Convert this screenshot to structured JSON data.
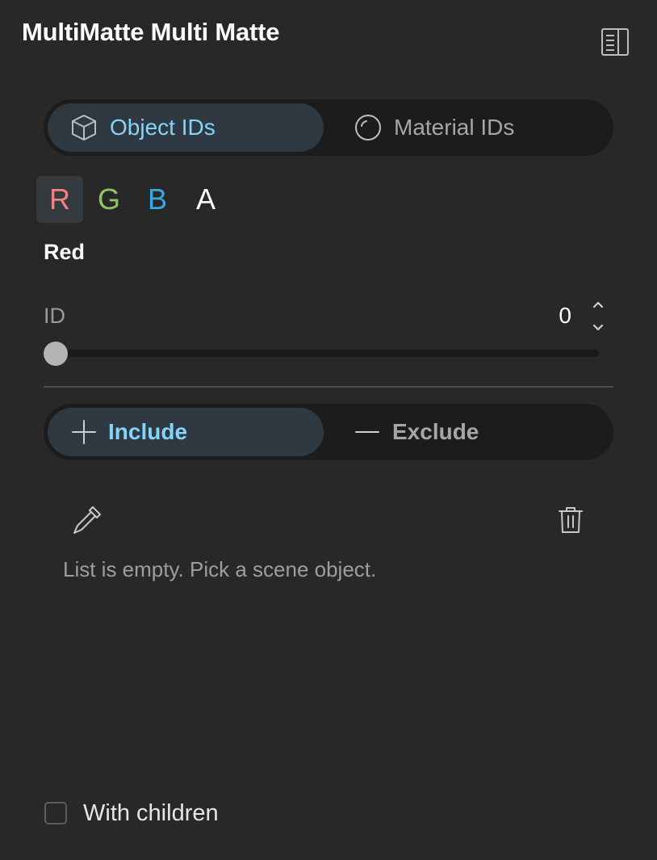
{
  "header": {
    "title": "MultiMatte Multi Matte",
    "panel_toggle_icon": "panel-layout-icon"
  },
  "id_type": {
    "options": [
      {
        "label": "Object IDs",
        "icon": "cube-icon",
        "active": true
      },
      {
        "label": "Material IDs",
        "icon": "sphere-icon",
        "active": false
      }
    ]
  },
  "channels": [
    {
      "label": "R",
      "color": "#f08282",
      "active": true
    },
    {
      "label": "G",
      "color": "#8fc56a",
      "active": false
    },
    {
      "label": "B",
      "color": "#3ba7df",
      "active": false
    },
    {
      "label": "A",
      "color": "#ffffff",
      "active": false
    }
  ],
  "section": {
    "title": "Red"
  },
  "id_field": {
    "label": "ID",
    "value": "0",
    "slider_fraction": 0
  },
  "mode": {
    "options": [
      {
        "label": "Include",
        "icon": "plus-icon",
        "active": true
      },
      {
        "label": "Exclude",
        "icon": "minus-icon",
        "active": false
      }
    ]
  },
  "list": {
    "empty_message": "List is empty. Pick a scene object.",
    "pick_icon": "eyedropper-icon",
    "clear_icon": "trash-icon"
  },
  "options": {
    "with_children_label": "With children",
    "with_children_checked": false
  },
  "colors": {
    "accent": "#84d3fb",
    "active_segment": "#2e3941",
    "background": "#282828"
  }
}
